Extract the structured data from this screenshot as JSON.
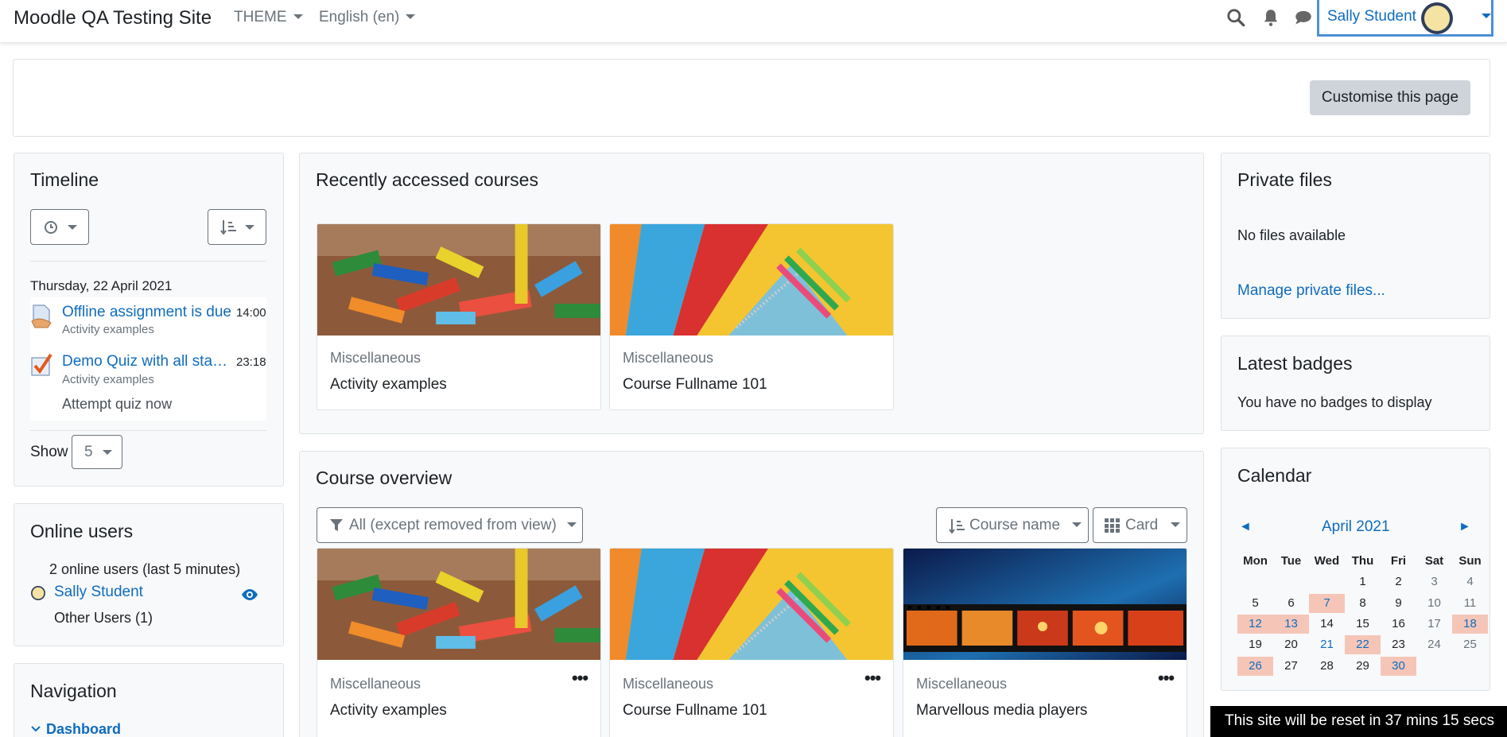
{
  "navbar": {
    "site_name": "Moodle QA Testing Site",
    "theme_menu": "THEME",
    "language_menu": "English (en)",
    "user_name": "Sally Student"
  },
  "header": {
    "customise_button": "Customise this page"
  },
  "timeline": {
    "title": "Timeline",
    "day": "Thursday, 22 April 2021",
    "events": [
      {
        "title": "Offline assignment is due",
        "course": "Activity examples",
        "time": "14:00"
      },
      {
        "title": "Demo Quiz with all sta…",
        "course": "Activity examples",
        "time": "23:18",
        "action": "Attempt quiz now"
      }
    ],
    "show_label": "Show",
    "show_value": "5"
  },
  "online_users": {
    "title": "Online users",
    "summary": "2 online users (last 5 minutes)",
    "user": "Sally Student",
    "other": "Other Users (1)"
  },
  "navigation": {
    "title": "Navigation",
    "dashboard": "Dashboard"
  },
  "recent": {
    "title": "Recently accessed courses",
    "courses": [
      {
        "category": "Miscellaneous",
        "name": "Activity examples"
      },
      {
        "category": "Miscellaneous",
        "name": "Course Fullname 101"
      }
    ]
  },
  "overview": {
    "title": "Course overview",
    "filter": "All (except removed from view)",
    "sort": "Course name",
    "view": "Card",
    "courses": [
      {
        "category": "Miscellaneous",
        "name": "Activity examples"
      },
      {
        "category": "Miscellaneous",
        "name": "Course Fullname 101"
      },
      {
        "category": "Miscellaneous",
        "name": "Marvellous media players"
      }
    ]
  },
  "private_files": {
    "title": "Private files",
    "empty": "No files available",
    "manage": "Manage private files..."
  },
  "badges": {
    "title": "Latest badges",
    "empty": "You have no badges to display"
  },
  "calendar": {
    "title": "Calendar",
    "month": "April 2021",
    "prev": "◄",
    "next": "►",
    "weekdays": [
      "Mon",
      "Tue",
      "Wed",
      "Thu",
      "Fri",
      "Sat",
      "Sun"
    ],
    "weeks": [
      [
        "",
        "",
        "",
        "1",
        "2",
        "3",
        "4"
      ],
      [
        "5",
        "6",
        "7",
        "8",
        "9",
        "10",
        "11"
      ],
      [
        "12",
        "13",
        "14",
        "15",
        "16",
        "17",
        "18"
      ],
      [
        "19",
        "20",
        "21",
        "22",
        "23",
        "24",
        "25"
      ],
      [
        "26",
        "27",
        "28",
        "29",
        "30",
        "",
        ""
      ]
    ],
    "event_days": [
      "7",
      "12",
      "13",
      "18",
      "22",
      "26",
      "30"
    ],
    "today": "21"
  },
  "reset_notice": "This site will be reset in 37 mins 15 secs",
  "colors": {
    "link": "#0f6cbf",
    "event_highlight": "#f5c6b8",
    "focus_border": "#4d90d6"
  }
}
